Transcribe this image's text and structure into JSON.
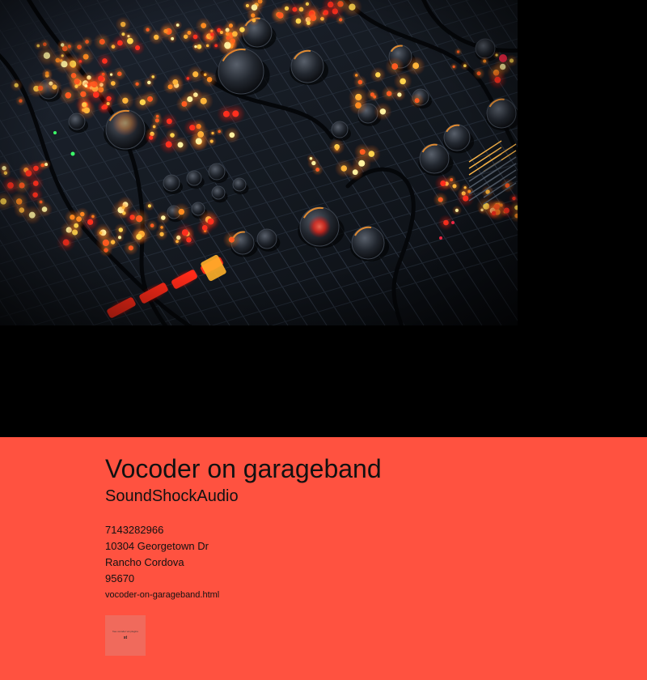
{
  "colors": {
    "page_background": "#000000",
    "footer_background": "#ff5240",
    "text": "#111111"
  },
  "hero": {
    "image_icon": "audio-mixing-console-photo"
  },
  "footer": {
    "title": "Vocoder on garageband",
    "brand": "SoundShockAudio",
    "phone": "7143282966",
    "street": "10304 Georgetown Dr",
    "city": "Rancho Cordova",
    "zip": "95670",
    "link_text": "vocoder-on-garageband.html",
    "thumbnail": {
      "caption": "free vocoder vst plugins",
      "mark": "st"
    }
  }
}
